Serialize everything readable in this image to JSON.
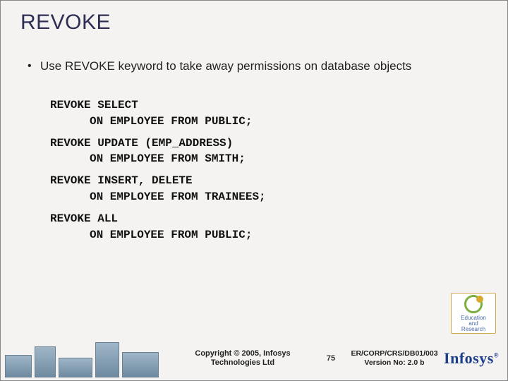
{
  "title": "REVOKE",
  "bullet": "Use REVOKE keyword to take away permissions on database objects",
  "code": {
    "l1": "REVOKE SELECT",
    "l2": "ON EMPLOYEE FROM PUBLIC;",
    "l3": "REVOKE UPDATE (EMP_ADDRESS)",
    "l4": "ON EMPLOYEE FROM SMITH;",
    "l5": "REVOKE INSERT, DELETE",
    "l6": "ON EMPLOYEE FROM TRAINEES;",
    "l7": "REVOKE ALL",
    "l8": "ON EMPLOYEE FROM PUBLIC;"
  },
  "footer": {
    "copyright_line1": "Copyright © 2005, Infosys",
    "copyright_line2": "Technologies Ltd",
    "page": "75",
    "doc_line1": "ER/CORP/CRS/DB01/003",
    "doc_line2": "Version No: 2.0 b",
    "logo_text": "Infosys",
    "logo_reg": "®"
  },
  "badge": {
    "line1": "Education",
    "line2": "and",
    "line3": "Research"
  }
}
